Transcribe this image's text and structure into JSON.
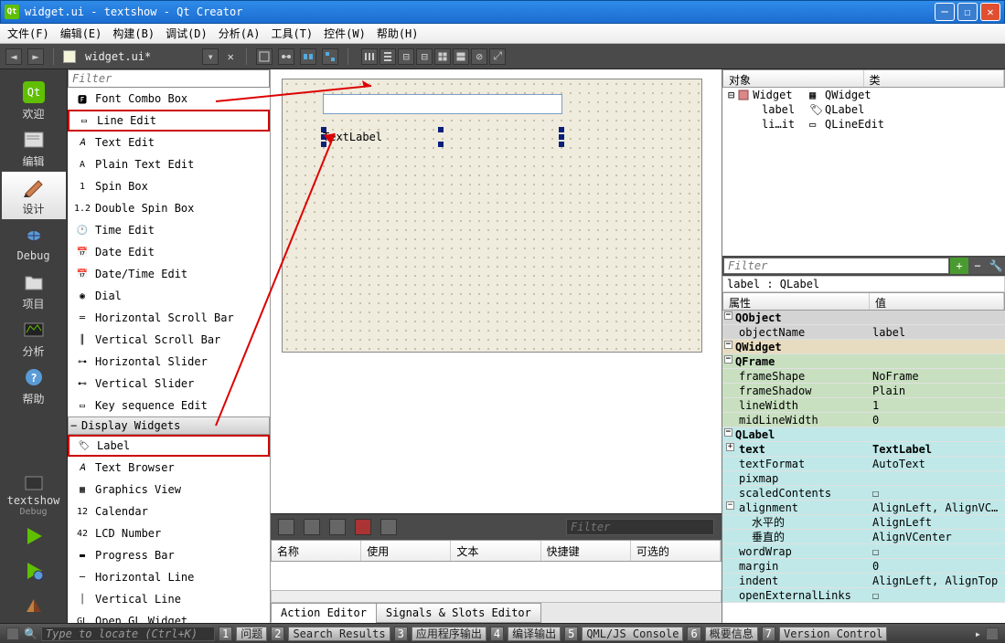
{
  "window": {
    "title": "widget.ui - textshow - Qt Creator"
  },
  "menu": {
    "file": "文件(F)",
    "edit": "编辑(E)",
    "build": "构建(B)",
    "debug": "调试(D)",
    "analyze": "分析(A)",
    "tools": "工具(T)",
    "widgets": "控件(W)",
    "help": "帮助(H)"
  },
  "toolbar": {
    "doc": "widget.ui*"
  },
  "modes": {
    "welcome": "欢迎",
    "edit": "编辑",
    "design": "设计",
    "debug": "Debug",
    "projects": "项目",
    "analyze": "分析",
    "help": "帮助"
  },
  "project": {
    "name": "textshow",
    "config": "Debug"
  },
  "widgetbox": {
    "filter": "Filter",
    "items": [
      "Font Combo Box",
      "Line Edit",
      "Text Edit",
      "Plain Text Edit",
      "Spin Box",
      "Double Spin Box",
      "Time Edit",
      "Date Edit",
      "Date/Time Edit",
      "Dial",
      "Horizontal Scroll Bar",
      "Vertical Scroll Bar",
      "Horizontal Slider",
      "Vertical Slider",
      "Key sequence Edit"
    ],
    "category": "Display Widgets",
    "items2": [
      "Label",
      "Text Browser",
      "Graphics View",
      "Calendar",
      "LCD Number",
      "Progress Bar",
      "Horizontal Line",
      "Vertical Line",
      "Open GL Widget"
    ]
  },
  "form": {
    "textlabel": "TextLabel"
  },
  "actionEditor": {
    "filter": "Filter",
    "cols": {
      "name": "名称",
      "used": "使用",
      "text": "文本",
      "shortcut": "快捷键",
      "checkable": "可选的"
    },
    "tab1": "Action Editor",
    "tab2": "Signals & Slots Editor"
  },
  "objTree": {
    "col1": "对象",
    "col2": "类",
    "rows": [
      {
        "obj": "Widget",
        "cls": "QWidget",
        "depth": 0
      },
      {
        "obj": "label",
        "cls": "QLabel",
        "depth": 1
      },
      {
        "obj": "li…it",
        "cls": "QLineEdit",
        "depth": 1
      }
    ]
  },
  "propPanel": {
    "filter": "Filter",
    "context": "label : QLabel",
    "col1": "属性",
    "col2": "值",
    "rows": [
      {
        "g": "qobject",
        "head": true,
        "n": "QObject",
        "v": ""
      },
      {
        "g": "qobject",
        "n": "objectName",
        "v": "label"
      },
      {
        "g": "qwidget",
        "head": true,
        "n": "QWidget",
        "v": ""
      },
      {
        "g": "qframe",
        "head": true,
        "n": "QFrame",
        "v": ""
      },
      {
        "g": "qframe",
        "n": "frameShape",
        "v": "NoFrame"
      },
      {
        "g": "qframe",
        "n": "frameShadow",
        "v": "Plain"
      },
      {
        "g": "qframe",
        "n": "lineWidth",
        "v": "1"
      },
      {
        "g": "qframe",
        "n": "midLineWidth",
        "v": "0"
      },
      {
        "g": "qlabel",
        "head": true,
        "n": "QLabel",
        "v": ""
      },
      {
        "g": "qlabel",
        "n": "text",
        "v": "TextLabel",
        "exp": true,
        "bold": true
      },
      {
        "g": "qlabel",
        "n": "textFormat",
        "v": "AutoText"
      },
      {
        "g": "qlabel",
        "n": "pixmap",
        "v": ""
      },
      {
        "g": "qlabel",
        "n": "scaledContents",
        "v": "☐"
      },
      {
        "g": "qlabel",
        "n": "alignment",
        "v": "AlignLeft, AlignVC…",
        "exp": true,
        "open": true
      },
      {
        "g": "qlabel",
        "n": "水平的",
        "v": "AlignLeft",
        "sub": true
      },
      {
        "g": "qlabel",
        "n": "垂直的",
        "v": "AlignVCenter",
        "sub": true
      },
      {
        "g": "qlabel",
        "n": "wordWrap",
        "v": "☐"
      },
      {
        "g": "qlabel",
        "n": "margin",
        "v": "0"
      },
      {
        "g": "qlabel",
        "n": "indent",
        "v": "AlignLeft, AlignTop"
      },
      {
        "g": "qlabel",
        "n": "openExternalLinks",
        "v": "☐"
      }
    ]
  },
  "status": {
    "locate": "Type to locate (Ctrl+K)",
    "s1": "问题",
    "s2": "Search Results",
    "s3": "应用程序输出",
    "s4": "编译输出",
    "s5": "QML/JS Console",
    "s6": "概要信息",
    "s7": "Version Control"
  }
}
